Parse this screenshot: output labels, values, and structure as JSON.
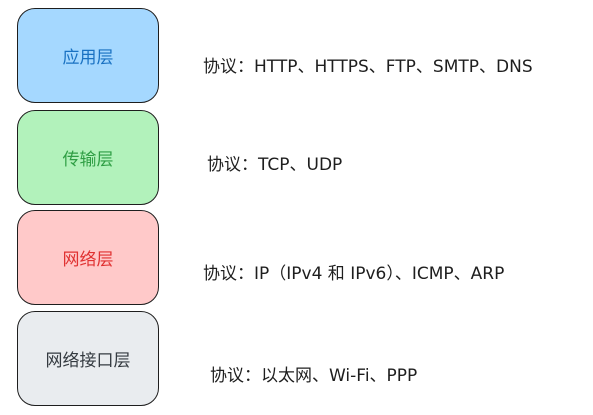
{
  "layers": [
    {
      "name": "应用层",
      "fill": "#a5d8ff",
      "text_color": "#1971c2",
      "protocols": "协议：HTTP、HTTPS、FTP、SMTP、DNS"
    },
    {
      "name": "传输层",
      "fill": "#b2f2bb",
      "text_color": "#2f9e44",
      "protocols": "协议：TCP、UDP"
    },
    {
      "name": "网络层",
      "fill": "#ffc9c9",
      "text_color": "#e03131",
      "protocols": "协议：IP（IPv4 和 IPv6）、ICMP、ARP"
    },
    {
      "name": "网络接口层",
      "fill": "#e9ecef",
      "text_color": "#343a40",
      "protocols": "协议：以太网、Wi-Fi、PPP"
    }
  ]
}
